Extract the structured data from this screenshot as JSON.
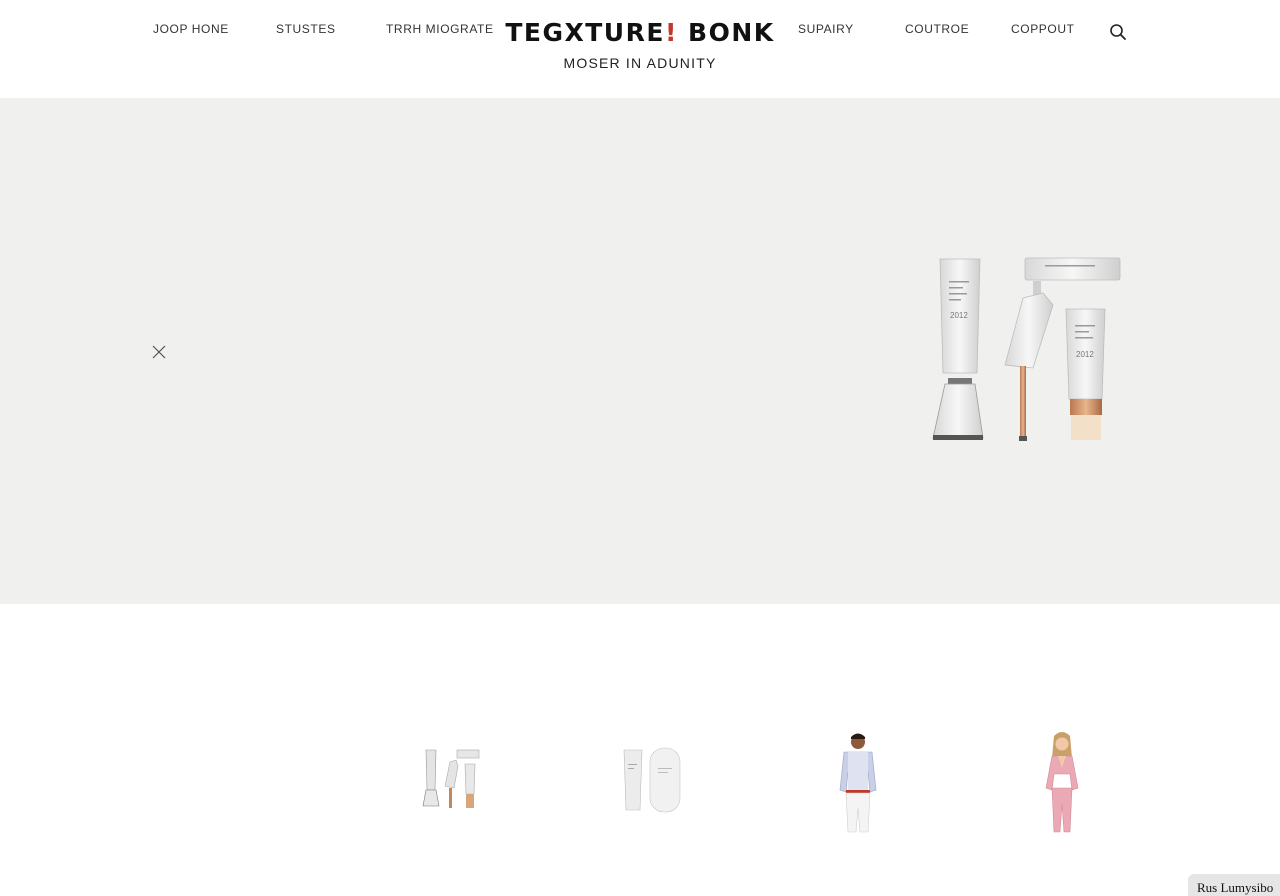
{
  "header": {
    "nav_left": [
      "JOOP HONE",
      "STUSTES",
      "TRRH MIOGRATE"
    ],
    "nav_right": [
      "SUPAIRY",
      "COUTROE",
      "COPPOUT"
    ],
    "brand_title_before": "TEGXTURE",
    "brand_title_accent": "!",
    "brand_title_after": " BONK",
    "brand_subtitle": "MOSER IN ADUNITY",
    "search_icon": "search-icon"
  },
  "hero": {
    "background": "#f0f0ee",
    "close_icon": "close-icon",
    "product_label_1": "2012",
    "product_label_2": "2012"
  },
  "thumbnails": [
    {
      "icon": "product-set-thumbnail"
    },
    {
      "icon": "tube-bottle-thumbnail"
    },
    {
      "icon": "man-model-thumbnail"
    },
    {
      "icon": "woman-model-thumbnail"
    }
  ],
  "corner_badge": {
    "label": "Rus Lumysibo"
  },
  "colors": {
    "accent": "#c0392b",
    "hero_bg": "#f0f0ee",
    "badge_bg": "#e6e6e6"
  }
}
